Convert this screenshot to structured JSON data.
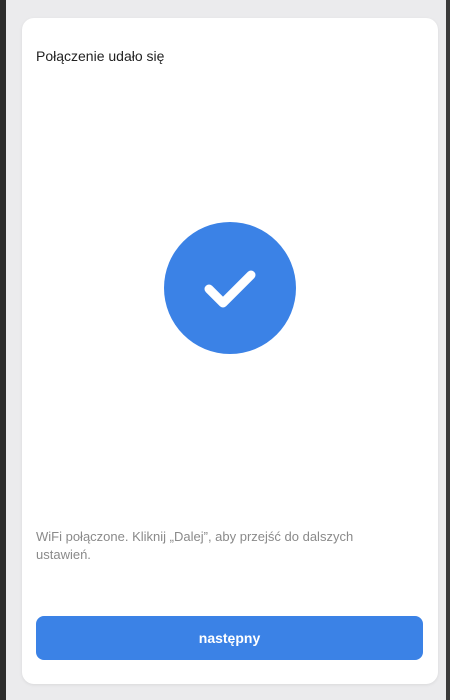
{
  "screen": {
    "title": "Połączenie udało się",
    "status_icon": "checkmark-icon",
    "message": "WiFi połączone. Kliknij „Dalej”, aby przejść do dalszych ustawień.",
    "next_button_label": "następny"
  },
  "colors": {
    "accent": "#3b82e6",
    "card_background": "#ffffff",
    "page_background": "#ebebed",
    "message_text": "#8a8a8a"
  }
}
